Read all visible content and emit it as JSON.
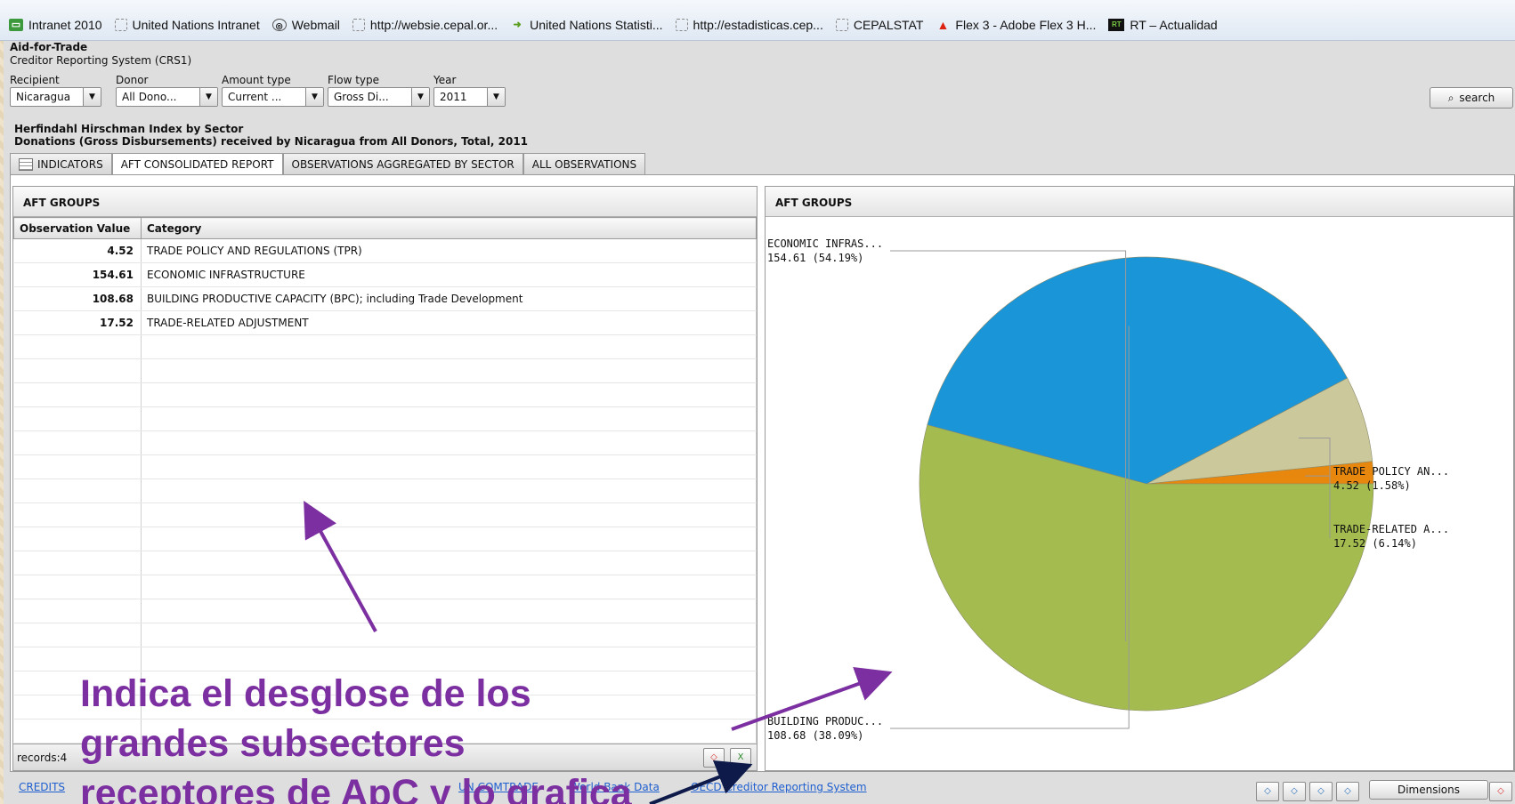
{
  "bookmarks": [
    {
      "label": "Intranet 2010",
      "icon": "green-page-icon"
    },
    {
      "label": "United Nations Intranet",
      "icon": "blank-page-icon"
    },
    {
      "label": "Webmail",
      "icon": "globe-icon"
    },
    {
      "label": "http://websie.cepal.or...",
      "icon": "blank-page-icon"
    },
    {
      "label": "United Nations Statisti...",
      "icon": "green-arrow-icon"
    },
    {
      "label": "http://estadisticas.cep...",
      "icon": "blank-page-icon"
    },
    {
      "label": "CEPALSTAT",
      "icon": "blank-page-icon"
    },
    {
      "label": "Flex 3 - Adobe Flex 3 H...",
      "icon": "adobe-icon"
    },
    {
      "label": "RT – Actualidad",
      "icon": "rt-logo-icon"
    }
  ],
  "app": {
    "title": "Aid-for-Trade",
    "subtitle": "Creditor Reporting System (CRS1)"
  },
  "filters": {
    "recipient": {
      "label": "Recipient",
      "value": "Nicaragua"
    },
    "donor": {
      "label": "Donor",
      "value": "All Dono..."
    },
    "amount_type": {
      "label": "Amount type",
      "value": "Current ..."
    },
    "flow_type": {
      "label": "Flow type",
      "value": "Gross Di..."
    },
    "year": {
      "label": "Year",
      "value": "2011"
    }
  },
  "search_label": "search",
  "report": {
    "title": "Herfindahl Hirschman Index by Sector",
    "subtitle": "Donations (Gross Disbursements) received by Nicaragua from All Donors, Total, 2011"
  },
  "tabs": [
    {
      "label": "INDICATORS"
    },
    {
      "label": "AFT CONSOLIDATED REPORT"
    },
    {
      "label": "OBSERVATIONS AGGREGATED BY SECTOR"
    },
    {
      "label": "ALL OBSERVATIONS"
    }
  ],
  "table_panel": {
    "header": "AFT GROUPS",
    "columns": [
      "Observation Value",
      "Category"
    ],
    "rows": [
      {
        "value": "4.52",
        "category": "TRADE POLICY AND REGULATIONS (TPR)"
      },
      {
        "value": "154.61",
        "category": "ECONOMIC INFRASTRUCTURE"
      },
      {
        "value": "108.68",
        "category": "BUILDING PRODUCTIVE CAPACITY (BPC); including Trade Development"
      },
      {
        "value": "17.52",
        "category": "TRADE-RELATED ADJUSTMENT"
      }
    ],
    "records": "records:4"
  },
  "chart_panel": {
    "header": "AFT GROUPS"
  },
  "chart_data": {
    "type": "pie",
    "slices": [
      {
        "name": "TRADE POLICY AN...",
        "value": 4.52,
        "label": "4.52 (1.58%)",
        "color": "#e8870e"
      },
      {
        "name": "TRADE-RELATED A...",
        "value": 17.52,
        "label": "17.52 (6.14%)",
        "color": "#cbc89c"
      },
      {
        "name": "BUILDING PRODUC...",
        "value": 108.68,
        "label": "108.68 (38.09%)",
        "color": "#1a95d8"
      },
      {
        "name": "ECONOMIC INFRAS...",
        "value": 154.61,
        "label": "154.61 (54.19%)",
        "color": "#a4bc4f"
      }
    ]
  },
  "links": [
    "CREDITS",
    "UN COMTRADE",
    "World Bank Data",
    "OECD Creditor Reporting System"
  ],
  "dimensions_label": "Dimensions",
  "annotation": {
    "line1": "Indica el desglose de los",
    "line2": "grandes subsectores",
    "line3": "receptores de ApC y lo grafica"
  },
  "colors": {
    "annotation": "#7b2fa0",
    "link": "#1f5fcf"
  }
}
